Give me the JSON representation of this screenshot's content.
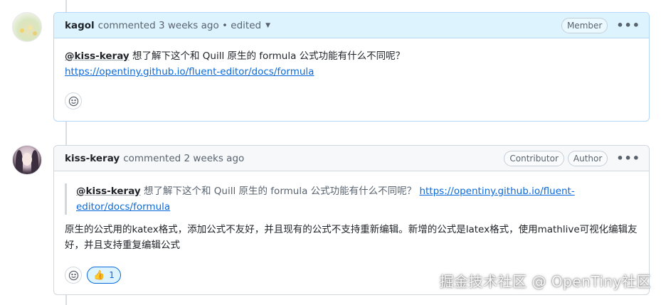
{
  "comments": [
    {
      "author": "kagol",
      "meta": "commented 3 weeks ago • edited",
      "badges": [
        "Member"
      ],
      "body_mention": "@kiss-keray",
      "body_text": " 想了解下这个和 Quill 原生的 formula 公式功能有什么不同呢？",
      "body_link": "https://opentiny.github.io/fluent-editor/docs/formula"
    },
    {
      "author": "kiss-keray",
      "meta": "commented 2 weeks ago",
      "badges": [
        "Contributor",
        "Author"
      ],
      "quote_mention": "@kiss-keray",
      "quote_text": " 想了解下这个和 Quill 原生的 formula 公式功能有什么不同呢？ ",
      "quote_link": "https://opentiny.github.io/fluent-editor/docs/formula",
      "body_text": "原生的公式用的katex格式，添加公式不友好，并且现有的公式不支持重新编辑。新增的公式是latex格式，使用mathlive可视化编辑友好，并且支持重复编辑公式",
      "reaction_emoji": "👍",
      "reaction_count": "1"
    }
  ],
  "icons": {
    "more": "kebab-horizontal-icon",
    "smiley": "smiley-icon",
    "caret": "triangle-down-icon"
  },
  "watermark": "掘金技术社区 @ OpenTiny社区"
}
